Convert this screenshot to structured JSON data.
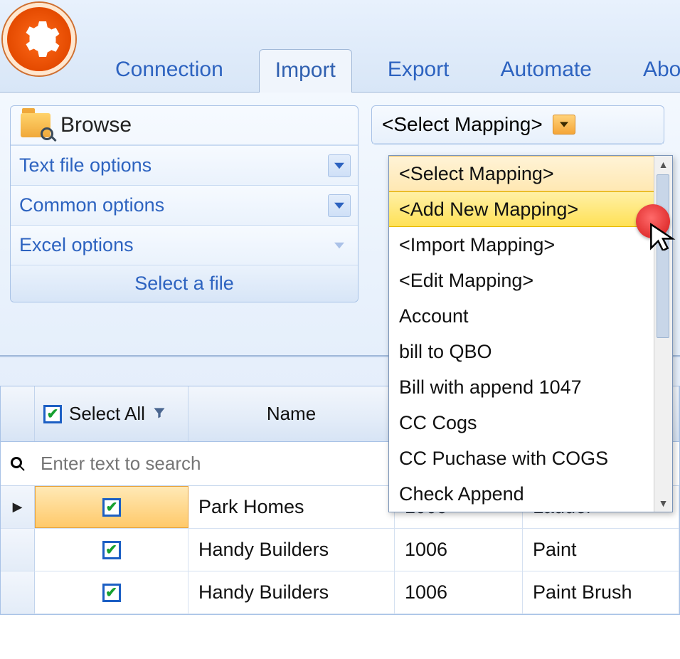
{
  "tabs": {
    "connection": "Connection",
    "import": "Import",
    "export": "Export",
    "automate": "Automate",
    "about": "About"
  },
  "left_panel": {
    "browse": "Browse",
    "text_file_options": "Text file options",
    "common_options": "Common options",
    "excel_options": "Excel options",
    "footer": "Select a file"
  },
  "mapping": {
    "combo_label": "<Select Mapping>",
    "items": [
      "<Select Mapping>",
      "<Add New Mapping>",
      "<Import Mapping>",
      "<Edit Mapping>",
      "Account",
      "bill to QBO",
      "Bill with append 1047",
      "CC Cogs",
      "CC Puchase with COGS",
      "Check Append"
    ],
    "selected_index": 0,
    "hover_index": 1
  },
  "grid": {
    "select_all_label": "Select All",
    "name_header": "Name",
    "search_placeholder": "Enter text to search",
    "rows": [
      {
        "checked": true,
        "name": "Park Homes",
        "num": "1005",
        "item": "Ladder",
        "current": true
      },
      {
        "checked": true,
        "name": "Handy Builders",
        "num": "1006",
        "item": "Paint",
        "current": false
      },
      {
        "checked": true,
        "name": "Handy Builders",
        "num": "1006",
        "item": "Paint Brush",
        "current": false
      }
    ]
  }
}
